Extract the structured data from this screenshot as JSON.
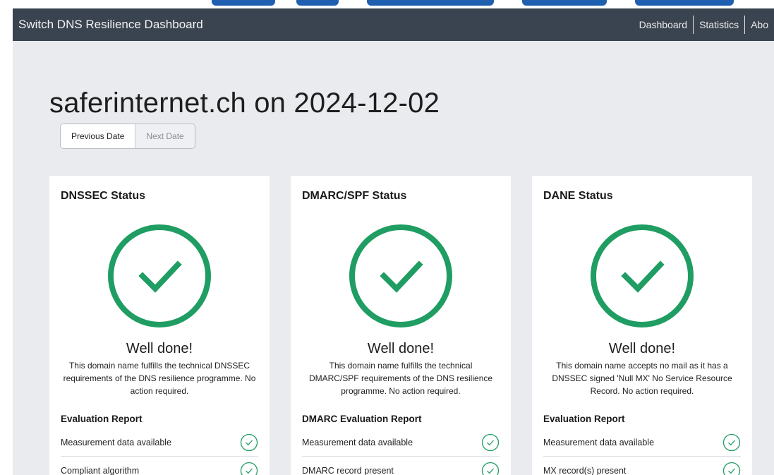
{
  "navbar": {
    "brand": "Switch DNS Resilience Dashboard",
    "links": [
      "Dashboard",
      "Statistics",
      "Abo"
    ]
  },
  "page": {
    "title": "saferinternet.ch on 2024-12-02",
    "previous_date_label": "Previous Date",
    "next_date_label": "Next Date"
  },
  "colors": {
    "success": "#1f9d63",
    "navbar": "#3a4450",
    "page_bg": "#e9ebee"
  },
  "cards": [
    {
      "title": "DNSSEC Status",
      "status_icon": "check-circle-icon",
      "headline": "Well done!",
      "description": "This domain name fulfills the technical DNSSEC requirements of the DNS resilience programme. No action required.",
      "report_title": "Evaluation Report",
      "report_rows": [
        {
          "label": "Measurement data available",
          "icon": "check-circle-icon"
        },
        {
          "label": "Compliant algorithm",
          "icon": "check-circle-icon"
        }
      ]
    },
    {
      "title": "DMARC/SPF Status",
      "status_icon": "check-circle-icon",
      "headline": "Well done!",
      "description": "This domain name fulfills the technical DMARC/SPF requirements of the DNS resilience programme. No action required.",
      "report_title": "DMARC Evaluation Report",
      "report_rows": [
        {
          "label": "Measurement data available",
          "icon": "check-circle-icon"
        },
        {
          "label": "DMARC record present",
          "icon": "check-circle-icon"
        }
      ]
    },
    {
      "title": "DANE Status",
      "status_icon": "check-circle-icon",
      "headline": "Well done!",
      "description": "This domain name accepts no mail as it has a DNSSEC signed 'Null MX' No Service Resource Record. No action required.",
      "report_title": "Evaluation Report",
      "report_rows": [
        {
          "label": "Measurement data available",
          "icon": "check-circle-icon"
        },
        {
          "label": "MX record(s) present",
          "icon": "check-circle-icon"
        }
      ]
    }
  ]
}
